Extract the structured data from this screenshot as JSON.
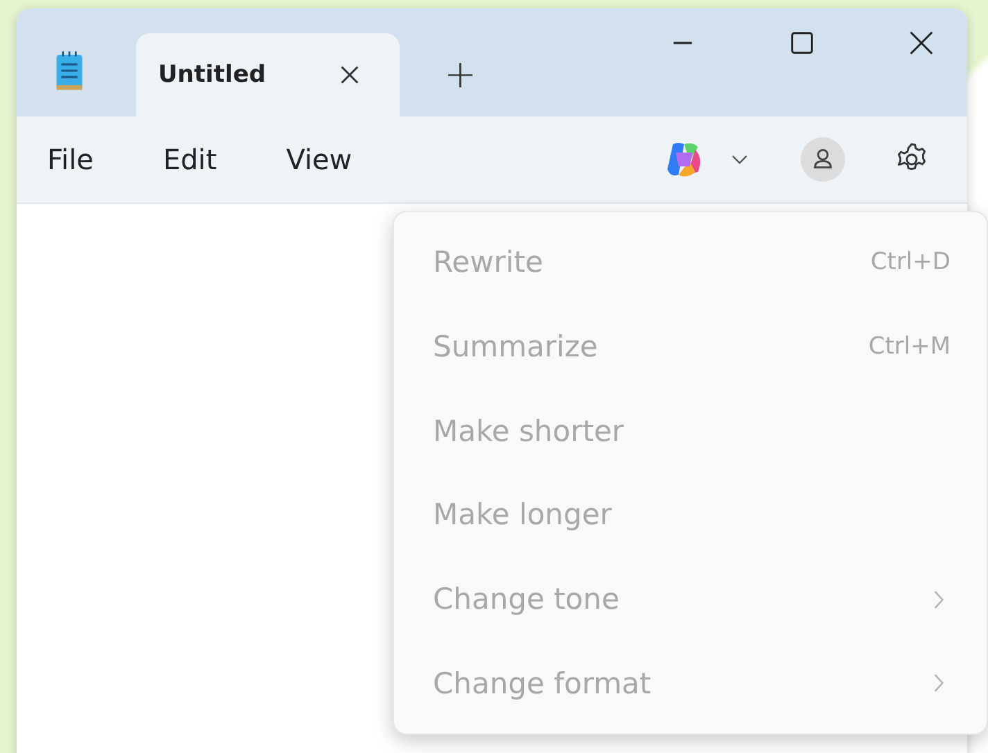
{
  "window": {
    "tab": {
      "title": "Untitled",
      "selected": true
    },
    "new_tab": "+"
  },
  "menubar": [
    "File",
    "Edit",
    "View"
  ],
  "menu": [
    {
      "label": "Rewrite",
      "shortcut": "Ctrl+D",
      "submenu": false,
      "disabled": true
    },
    {
      "label": "Summarize",
      "shortcut": "Ctrl+M",
      "submenu": false,
      "disabled": true
    },
    {
      "label": "Make shorter",
      "submenu": false,
      "disabled": true
    },
    {
      "label": "Make longer",
      "submenu": false,
      "disabled": true
    },
    {
      "label": "Change tone",
      "submenu": true,
      "disabled": true
    },
    {
      "label": "Change format",
      "submenu": true,
      "disabled": true
    }
  ]
}
